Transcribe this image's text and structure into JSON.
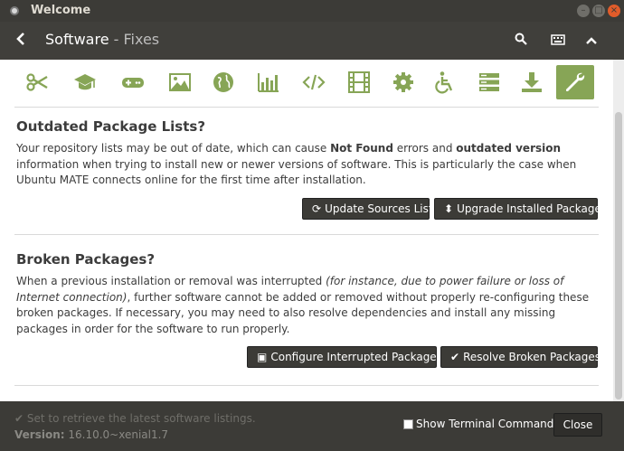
{
  "window": {
    "title": "Welcome"
  },
  "header": {
    "title": "Software",
    "separator": " - ",
    "subtitle": "Fixes"
  },
  "categories": [
    {
      "name": "accessories",
      "icon": "scissors-icon"
    },
    {
      "name": "education",
      "icon": "graduation-cap-icon"
    },
    {
      "name": "games",
      "icon": "gamepad-icon"
    },
    {
      "name": "graphics",
      "icon": "image-icon"
    },
    {
      "name": "internet",
      "icon": "globe-icon"
    },
    {
      "name": "office",
      "icon": "bar-chart-icon"
    },
    {
      "name": "programming",
      "icon": "code-icon"
    },
    {
      "name": "sound-video",
      "icon": "film-icon"
    },
    {
      "name": "system-tools",
      "icon": "gear-icon"
    },
    {
      "name": "universal-access",
      "icon": "wheelchair-icon"
    },
    {
      "name": "servers",
      "icon": "server-icon"
    },
    {
      "name": "more-software",
      "icon": "download-icon"
    },
    {
      "name": "fixes",
      "icon": "wrench-icon",
      "active": true
    }
  ],
  "outdated": {
    "heading": "Outdated Package Lists?",
    "p1": "Your repository lists may be out of date, which can cause ",
    "b1": "Not Found",
    "p2": " errors and ",
    "b2": "outdated version",
    "p3": " information when trying to install new or newer versions of software. This is particularly the case when Ubuntu MATE connects online for the first time after installation.",
    "update_button": "Update Sources List",
    "upgrade_button": "Upgrade Installed Packages"
  },
  "broken": {
    "heading": "Broken Packages?",
    "p1": "When a previous installation or removal was interrupted ",
    "i1": "(for instance, due to power failure or loss of Internet connection)",
    "p2": ", further software cannot be added or removed without properly re-configuring these broken packages. If necessary, you may need to also resolve dependencies and install any missing packages in order for the software to run properly.",
    "configure_button": "Configure Interrupted Packages",
    "resolve_button": "Resolve Broken Packages"
  },
  "footer": {
    "status": "Set to retrieve the latest software listings.",
    "version_label": "Version:",
    "version_value": "16.10.0~xenial1.7",
    "show_terminal_label": "Show Terminal Commands",
    "show_terminal_checked": false,
    "close_label": "Close"
  },
  "colors": {
    "accent": "#87a556",
    "titlebar": "#3c3b37",
    "button": "#3c3b37"
  }
}
